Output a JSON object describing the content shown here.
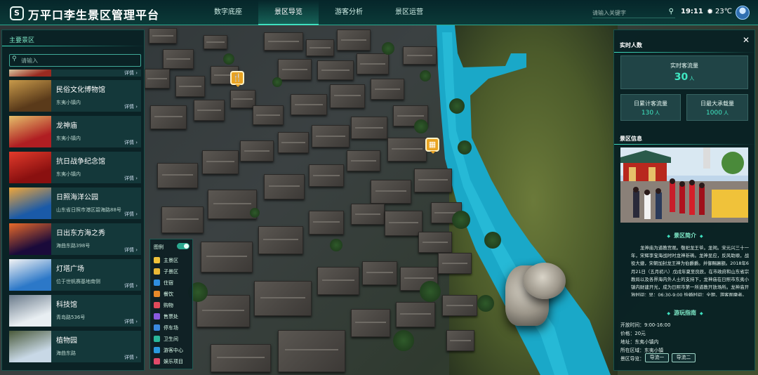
{
  "app": {
    "title": "万平口李生景区管理平台",
    "logo_glyph": "S"
  },
  "nav": {
    "tabs": [
      {
        "label": "数字底座",
        "active": false
      },
      {
        "label": "景区导览",
        "active": true
      },
      {
        "label": "游客分析",
        "active": false
      },
      {
        "label": "景区运营",
        "active": false
      }
    ]
  },
  "header": {
    "search_placeholder": "请输入关键字",
    "time": "19:11",
    "temperature": "23℃",
    "weather_icon": "sun-icon"
  },
  "left_panel": {
    "title": "主要景区",
    "search_placeholder": "请输入",
    "detail_label": "详情",
    "spots": [
      {
        "name": "",
        "address": "",
        "thumb": [
          "#9a2a20",
          "#d9c7a0"
        ],
        "partial": true
      },
      {
        "name": "民俗文化博物馆",
        "address": "东夷小镇内",
        "thumb": [
          "#5a3a1a",
          "#c89a4a"
        ]
      },
      {
        "name": "龙神庙",
        "address": "东夷小镇内",
        "thumb": [
          "#b01e22",
          "#e5c06a"
        ]
      },
      {
        "name": "抗日战争纪念馆",
        "address": "东夷小镇内",
        "thumb": [
          "#8a1010",
          "#e23b2b"
        ]
      },
      {
        "name": "日照海洋公园",
        "address": "山东省日照市港区碧海路88号",
        "thumb": [
          "#1a5aa8",
          "#f0a63a"
        ]
      },
      {
        "name": "日出东方海之秀",
        "address": "海曲东路398号",
        "thumb": [
          "#1a0a3a",
          "#e86a2a"
        ]
      },
      {
        "name": "灯塔广场",
        "address": "位于世帆赛基地南侧",
        "thumb": [
          "#2c78c8",
          "#f4f4f4"
        ]
      },
      {
        "name": "科技馆",
        "address": "青岛路536号",
        "thumb": [
          "#e8eef2",
          "#6a7a8a"
        ]
      },
      {
        "name": "植物园",
        "address": "海曲东路",
        "thumb": [
          "#c8d8e6",
          "#4a5a3a"
        ]
      }
    ]
  },
  "legend": {
    "title": "图例",
    "toggle_on": true,
    "items": [
      {
        "label": "主景区",
        "color": "#f0c23a",
        "icon": "person-icon"
      },
      {
        "label": "子景区",
        "color": "#e8b836",
        "icon": "person-icon"
      },
      {
        "label": "住宿",
        "color": "#2f8fe0",
        "icon": "bed-icon"
      },
      {
        "label": "餐饮",
        "color": "#e88a2a",
        "icon": "dining-icon"
      },
      {
        "label": "购物",
        "color": "#e04a5a",
        "icon": "shopping-icon"
      },
      {
        "label": "售票处",
        "color": "#8a5ae0",
        "icon": "ticket-icon"
      },
      {
        "label": "停车场",
        "color": "#3a8ae0",
        "icon": "parking-icon"
      },
      {
        "label": "卫生间",
        "color": "#2ab89a",
        "icon": "toilet-icon"
      },
      {
        "label": "游客中心",
        "color": "#2a9ae0",
        "icon": "info-icon"
      },
      {
        "label": "娱乐项目",
        "color": "#e04a6a",
        "icon": "entertainment-icon"
      }
    ]
  },
  "map": {
    "pois": [
      {
        "glyph": "🍴",
        "icon": "dining-icon"
      },
      {
        "glyph": "▦",
        "icon": "building-icon"
      }
    ]
  },
  "right_panel": {
    "realtime_title": "实时人数",
    "realtime_label": "实时客流量",
    "realtime_value": "30",
    "unit": "人",
    "daily_label": "日累计客流量",
    "daily_value": "130",
    "capacity_label": "日最大承载量",
    "capacity_value": "1000",
    "scenic_title": "景区信息",
    "intro_title": "景区简介",
    "intro_text": "龙神庙为道教宫观。敬祀龙王爷。龙祠。宋元兴三十一年，宋辉李宝海战时时龙神祈祷。龙神显应，反风助顺，战役大捷，宋朝加封龙王神为伯爵爵。并御赐匾额。2018年6月21日（五月初八）戊戌年夏至良辰，在市政府和山东省宗教局以及各界海内外人士的支持下，龙神庙在日照市东夷小镇内财建开光，成为日照市第一所道教开放场所。龙神庙开放时间：早：06:30-9:00 恰婚时间：全期，游客观摩者。",
    "guide_title": "游玩指南",
    "guide": {
      "hours": "开放时间：9:00-16:00",
      "price": "价格：20元",
      "address": "地址：东夷小镇内",
      "area": "所在区域：东夷小镇",
      "nav_label": "景区导览：",
      "nav_btn1": "导流一",
      "nav_btn2": "导流二"
    }
  }
}
